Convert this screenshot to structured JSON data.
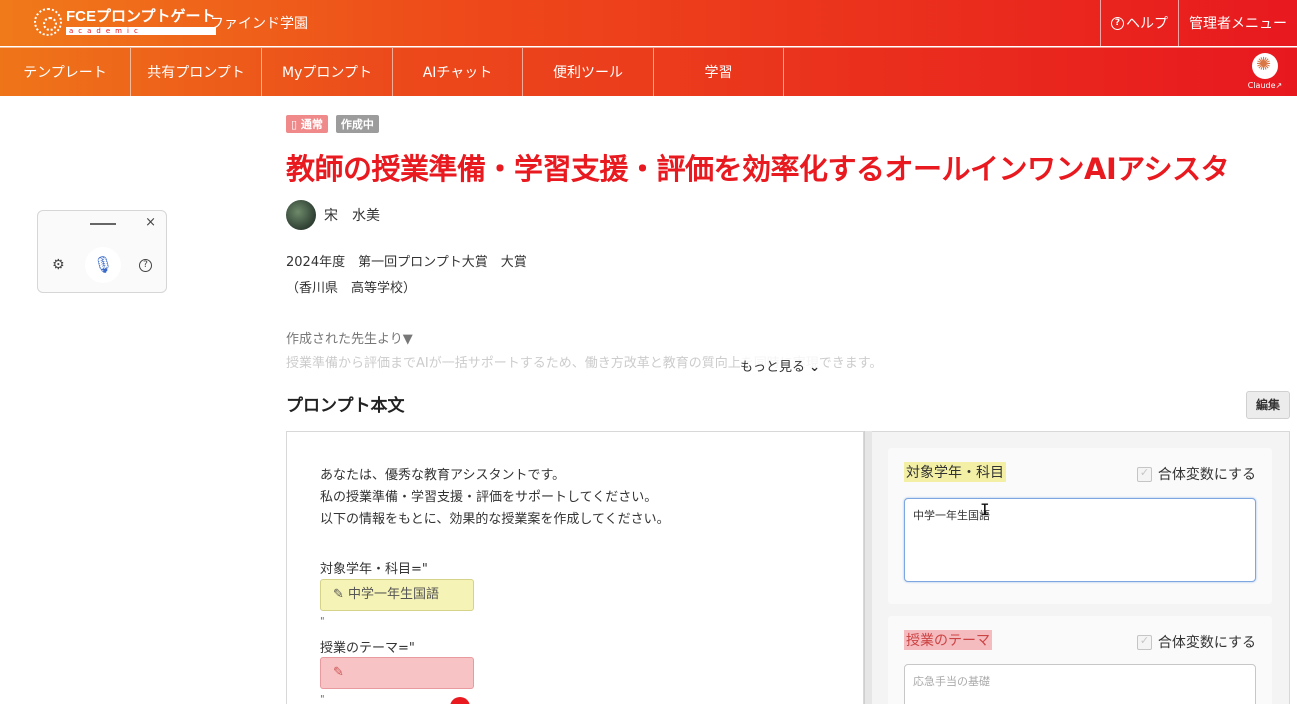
{
  "header": {
    "logo_main": "FCEプロンプトゲート",
    "logo_sub": "academic",
    "app_name": "ファインド学園",
    "help_label": "ヘルプ",
    "admin_label": "管理者メニュー"
  },
  "nav": {
    "items": [
      "テンプレート",
      "共有プロンプト",
      "Myプロンプト",
      "AIチャット",
      "便利ツール",
      "学習"
    ],
    "claude_label": "Claude↗"
  },
  "widget": {
    "close": "×"
  },
  "page": {
    "tags": {
      "normal": "通常",
      "draft": "作成中"
    },
    "title": "教師の授業準備・学習支援・評価を効率化するオールインワンAIアシスタ",
    "author": "宋　水美",
    "award_line1": "2024年度　第一回プロンプト大賞　大賞",
    "award_line2": "（香川県　高等学校）",
    "desc_title": "作成された先生より▼",
    "desc_text": "授業準備から評価までAIが一括サポートするため、働き方改革と教育の質向上を同時に実現できます。",
    "more_label": "もっと見る",
    "section_title": "プロンプト本文",
    "edit_label": "編集"
  },
  "prompt": {
    "lines": [
      "あなたは、優秀な教育アシスタントです。",
      "私の授業準備・学習支援・評価をサポートしてください。",
      "以下の情報をもとに、効果的な授業案を作成してください。"
    ],
    "var1_label": "対象学年・科目=\"",
    "var1_value": "中学一年生国語",
    "quote": "\"",
    "var2_label": "授業のテーマ=\"",
    "var2_value": ""
  },
  "variables": [
    {
      "label": "対象学年・科目",
      "merge_label": "合体変数にする",
      "value": "中学一年生国語",
      "placeholder": ""
    },
    {
      "label": "授業のテーマ",
      "merge_label": "合体変数にする",
      "value": "",
      "placeholder": "応急手当の基礎"
    }
  ],
  "colors": {
    "brand_red": "#e8191f",
    "brand_orange": "#f07a1a",
    "var_yellow": "#f5f3b5",
    "var_pink": "#f7c3c5"
  }
}
